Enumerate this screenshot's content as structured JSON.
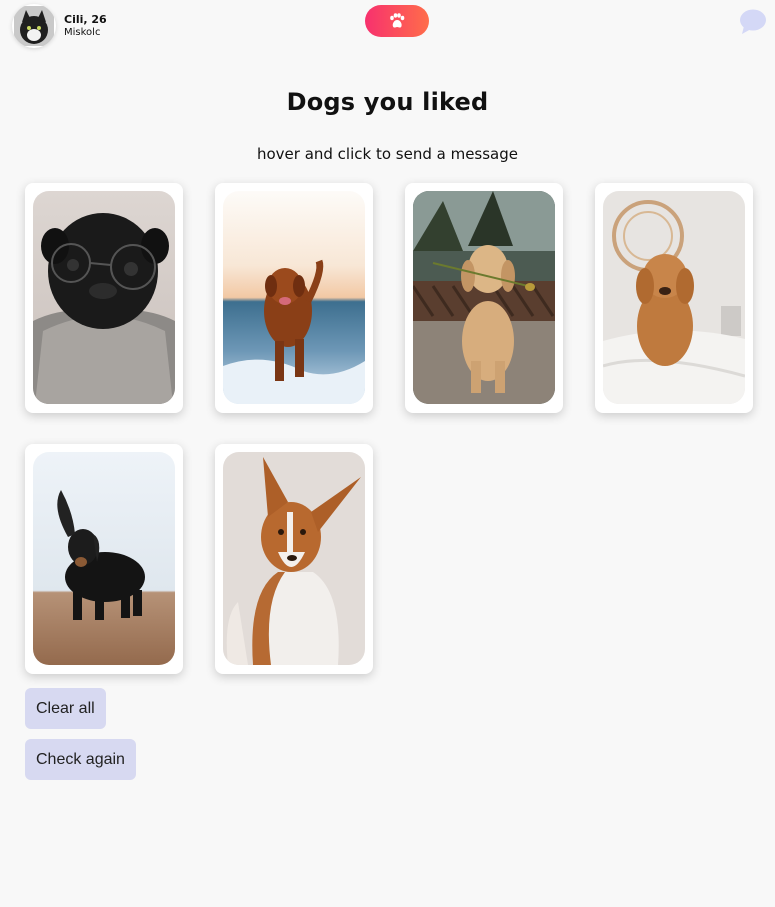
{
  "profile": {
    "name": "Cili, 26",
    "city": "Miskolc"
  },
  "header": {
    "paw_icon": "paw-icon",
    "chat_icon": "chat-bubble-icon"
  },
  "main": {
    "title": "Dogs you liked",
    "subtitle": "hover and click to send a message",
    "dogs": [
      {
        "photo": "pug-with-glasses"
      },
      {
        "photo": "retriever-running-on-beach"
      },
      {
        "photo": "golden-retriever-with-rose"
      },
      {
        "photo": "goldendoodle-on-bed"
      },
      {
        "photo": "dachshund-ear-up"
      },
      {
        "photo": "basenji-portrait"
      }
    ]
  },
  "actions": {
    "clear_label": "Clear all",
    "check_label": "Check again"
  },
  "colors": {
    "accent_gradient_start": "#f7316e",
    "accent_gradient_end": "#ff6d4a",
    "button_bg": "#d7d9f1",
    "chat_icon": "#d4d8f6"
  }
}
